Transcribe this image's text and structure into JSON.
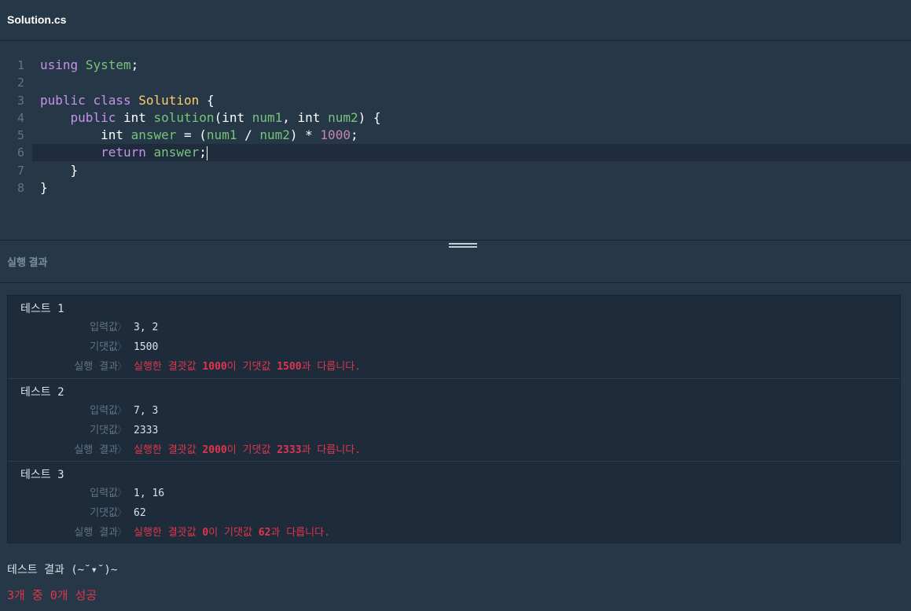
{
  "tab": {
    "title": "Solution.cs"
  },
  "editor": {
    "active_line": 6,
    "lines": [
      {
        "n": "1",
        "tokens": [
          [
            "kw",
            "using"
          ],
          [
            "plain",
            " "
          ],
          [
            "type",
            "System"
          ],
          [
            "plain",
            ";"
          ]
        ]
      },
      {
        "n": "2",
        "tokens": []
      },
      {
        "n": "3",
        "tokens": [
          [
            "kw",
            "public"
          ],
          [
            "plain",
            " "
          ],
          [
            "kw",
            "class"
          ],
          [
            "plain",
            " "
          ],
          [
            "cls",
            "Solution"
          ],
          [
            "plain",
            " {"
          ]
        ]
      },
      {
        "n": "4",
        "tokens": [
          [
            "plain",
            "    "
          ],
          [
            "kw",
            "public"
          ],
          [
            "plain",
            " int "
          ],
          [
            "fn",
            "solution"
          ],
          [
            "plain",
            "(int "
          ],
          [
            "var",
            "num1"
          ],
          [
            "plain",
            ", int "
          ],
          [
            "var",
            "num2"
          ],
          [
            "plain",
            ") {"
          ]
        ]
      },
      {
        "n": "5",
        "tokens": [
          [
            "plain",
            "        int "
          ],
          [
            "var",
            "answer"
          ],
          [
            "plain",
            " = ("
          ],
          [
            "var",
            "num1"
          ],
          [
            "plain",
            " / "
          ],
          [
            "var",
            "num2"
          ],
          [
            "plain",
            ") * "
          ],
          [
            "num",
            "1000"
          ],
          [
            "plain",
            ";"
          ]
        ]
      },
      {
        "n": "6",
        "tokens": [
          [
            "plain",
            "        "
          ],
          [
            "kw",
            "return"
          ],
          [
            "plain",
            " "
          ],
          [
            "var",
            "answer"
          ],
          [
            "plain",
            ";"
          ]
        ]
      },
      {
        "n": "7",
        "tokens": [
          [
            "plain",
            "    }"
          ]
        ]
      },
      {
        "n": "8",
        "tokens": [
          [
            "plain",
            "}"
          ]
        ]
      }
    ]
  },
  "result_panel": {
    "title": "실행 결과"
  },
  "labels": {
    "input": "입력값",
    "expected": "기댓값",
    "result": "실행 결과",
    "separator": "〉"
  },
  "tests": [
    {
      "title": "테스트 1",
      "input": "3, 2",
      "expected": "1500",
      "result_prefix": "실행한 결괏값 ",
      "result_actual": "1000",
      "result_mid": "이 기댓값 ",
      "result_expected": "1500",
      "result_suffix": "과 다릅니다."
    },
    {
      "title": "테스트 2",
      "input": "7, 3",
      "expected": "2333",
      "result_prefix": "실행한 결괏값 ",
      "result_actual": "2000",
      "result_mid": "이 기댓값 ",
      "result_expected": "2333",
      "result_suffix": "과 다릅니다."
    },
    {
      "title": "테스트 3",
      "input": "1, 16",
      "expected": "62",
      "result_prefix": "실행한 결괏값 ",
      "result_actual": "0",
      "result_mid": "이 기댓값 ",
      "result_expected": "62",
      "result_suffix": "과 다릅니다."
    }
  ],
  "summary": {
    "title": "테스트 결과 (~˘▾˘)~",
    "status": "3개 중 0개 성공"
  },
  "colors": {
    "background": "#263747",
    "results_bg": "#1e2b3b",
    "error": "#e0364c",
    "keyword": "#c792ea",
    "class": "#ffcb6b",
    "identifier": "#78c47a",
    "number": "#c884b4"
  }
}
